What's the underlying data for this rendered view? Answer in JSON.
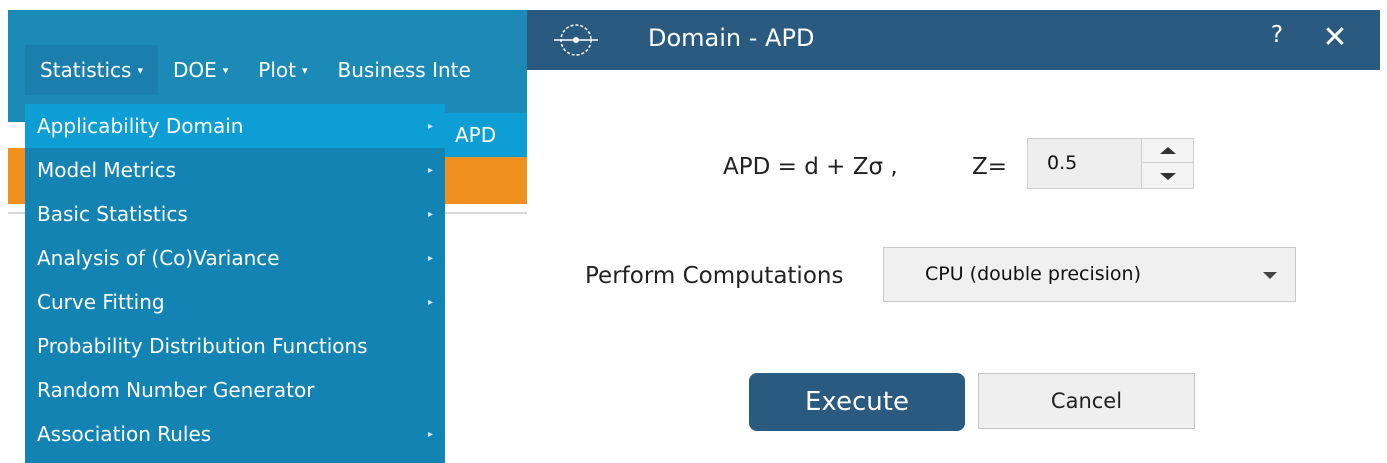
{
  "menubar": {
    "items": [
      {
        "label": "Statistics",
        "caret": "▾"
      },
      {
        "label": "DOE",
        "caret": "▾"
      },
      {
        "label": "Plot",
        "caret": "▾"
      },
      {
        "label": "Business Inte",
        "caret": ""
      }
    ]
  },
  "statistics_menu": {
    "items": [
      {
        "label": "Applicability Domain",
        "has_submenu": true
      },
      {
        "label": "Model Metrics",
        "has_submenu": true
      },
      {
        "label": "Basic Statistics",
        "has_submenu": true
      },
      {
        "label": "Analysis of (Co)Variance",
        "has_submenu": true
      },
      {
        "label": "Curve Fitting",
        "has_submenu": true
      },
      {
        "label": "Probability Distribution Functions",
        "has_submenu": false
      },
      {
        "label": "Random Number Generator",
        "has_submenu": false
      },
      {
        "label": "Association Rules",
        "has_submenu": true
      }
    ],
    "submenu_arrow": "▸"
  },
  "submenu": {
    "items": [
      {
        "label": "APD"
      }
    ]
  },
  "dialog": {
    "title": "Domain - APD",
    "help_label": "?",
    "close_label": "✕",
    "formula": "APD = d + Zσ ,",
    "z_label": "Z=",
    "z_value": "0.5",
    "perform_label": "Perform Computations",
    "compute_option": "CPU (double precision)",
    "execute_label": "Execute",
    "cancel_label": "Cancel"
  },
  "colors": {
    "menu_blue": "#1283b3",
    "menu_highlight": "#0d9ed6",
    "orange_band": "#f0901f",
    "dialog_titlebar": "#2b5a80"
  },
  "icons": {
    "app": "app-logo-icon",
    "submenu": "chevron-right-icon",
    "spin_up": "arrow-up-icon",
    "spin_down": "arrow-down-icon",
    "select": "chevron-down-icon"
  }
}
